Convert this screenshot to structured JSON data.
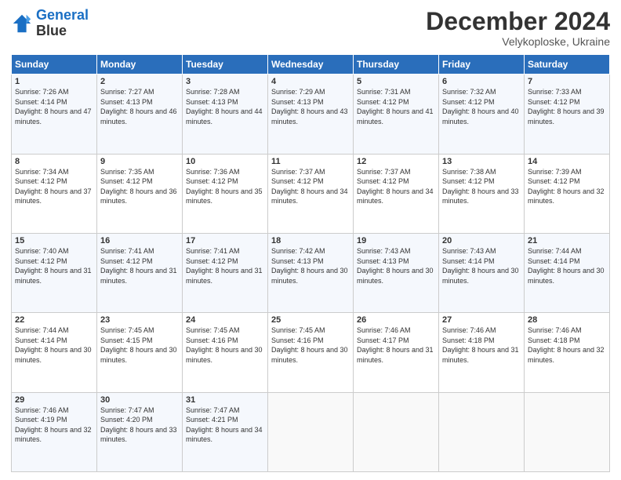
{
  "logo": {
    "line1": "General",
    "line2": "Blue"
  },
  "header": {
    "month": "December 2024",
    "location": "Velykoploske, Ukraine"
  },
  "days": [
    "Sunday",
    "Monday",
    "Tuesday",
    "Wednesday",
    "Thursday",
    "Friday",
    "Saturday"
  ],
  "weeks": [
    [
      {
        "day": "1",
        "sunrise": "Sunrise: 7:26 AM",
        "sunset": "Sunset: 4:14 PM",
        "daylight": "Daylight: 8 hours and 47 minutes."
      },
      {
        "day": "2",
        "sunrise": "Sunrise: 7:27 AM",
        "sunset": "Sunset: 4:13 PM",
        "daylight": "Daylight: 8 hours and 46 minutes."
      },
      {
        "day": "3",
        "sunrise": "Sunrise: 7:28 AM",
        "sunset": "Sunset: 4:13 PM",
        "daylight": "Daylight: 8 hours and 44 minutes."
      },
      {
        "day": "4",
        "sunrise": "Sunrise: 7:29 AM",
        "sunset": "Sunset: 4:13 PM",
        "daylight": "Daylight: 8 hours and 43 minutes."
      },
      {
        "day": "5",
        "sunrise": "Sunrise: 7:31 AM",
        "sunset": "Sunset: 4:12 PM",
        "daylight": "Daylight: 8 hours and 41 minutes."
      },
      {
        "day": "6",
        "sunrise": "Sunrise: 7:32 AM",
        "sunset": "Sunset: 4:12 PM",
        "daylight": "Daylight: 8 hours and 40 minutes."
      },
      {
        "day": "7",
        "sunrise": "Sunrise: 7:33 AM",
        "sunset": "Sunset: 4:12 PM",
        "daylight": "Daylight: 8 hours and 39 minutes."
      }
    ],
    [
      {
        "day": "8",
        "sunrise": "Sunrise: 7:34 AM",
        "sunset": "Sunset: 4:12 PM",
        "daylight": "Daylight: 8 hours and 37 minutes."
      },
      {
        "day": "9",
        "sunrise": "Sunrise: 7:35 AM",
        "sunset": "Sunset: 4:12 PM",
        "daylight": "Daylight: 8 hours and 36 minutes."
      },
      {
        "day": "10",
        "sunrise": "Sunrise: 7:36 AM",
        "sunset": "Sunset: 4:12 PM",
        "daylight": "Daylight: 8 hours and 35 minutes."
      },
      {
        "day": "11",
        "sunrise": "Sunrise: 7:37 AM",
        "sunset": "Sunset: 4:12 PM",
        "daylight": "Daylight: 8 hours and 34 minutes."
      },
      {
        "day": "12",
        "sunrise": "Sunrise: 7:37 AM",
        "sunset": "Sunset: 4:12 PM",
        "daylight": "Daylight: 8 hours and 34 minutes."
      },
      {
        "day": "13",
        "sunrise": "Sunrise: 7:38 AM",
        "sunset": "Sunset: 4:12 PM",
        "daylight": "Daylight: 8 hours and 33 minutes."
      },
      {
        "day": "14",
        "sunrise": "Sunrise: 7:39 AM",
        "sunset": "Sunset: 4:12 PM",
        "daylight": "Daylight: 8 hours and 32 minutes."
      }
    ],
    [
      {
        "day": "15",
        "sunrise": "Sunrise: 7:40 AM",
        "sunset": "Sunset: 4:12 PM",
        "daylight": "Daylight: 8 hours and 31 minutes."
      },
      {
        "day": "16",
        "sunrise": "Sunrise: 7:41 AM",
        "sunset": "Sunset: 4:12 PM",
        "daylight": "Daylight: 8 hours and 31 minutes."
      },
      {
        "day": "17",
        "sunrise": "Sunrise: 7:41 AM",
        "sunset": "Sunset: 4:12 PM",
        "daylight": "Daylight: 8 hours and 31 minutes."
      },
      {
        "day": "18",
        "sunrise": "Sunrise: 7:42 AM",
        "sunset": "Sunset: 4:13 PM",
        "daylight": "Daylight: 8 hours and 30 minutes."
      },
      {
        "day": "19",
        "sunrise": "Sunrise: 7:43 AM",
        "sunset": "Sunset: 4:13 PM",
        "daylight": "Daylight: 8 hours and 30 minutes."
      },
      {
        "day": "20",
        "sunrise": "Sunrise: 7:43 AM",
        "sunset": "Sunset: 4:14 PM",
        "daylight": "Daylight: 8 hours and 30 minutes."
      },
      {
        "day": "21",
        "sunrise": "Sunrise: 7:44 AM",
        "sunset": "Sunset: 4:14 PM",
        "daylight": "Daylight: 8 hours and 30 minutes."
      }
    ],
    [
      {
        "day": "22",
        "sunrise": "Sunrise: 7:44 AM",
        "sunset": "Sunset: 4:14 PM",
        "daylight": "Daylight: 8 hours and 30 minutes."
      },
      {
        "day": "23",
        "sunrise": "Sunrise: 7:45 AM",
        "sunset": "Sunset: 4:15 PM",
        "daylight": "Daylight: 8 hours and 30 minutes."
      },
      {
        "day": "24",
        "sunrise": "Sunrise: 7:45 AM",
        "sunset": "Sunset: 4:16 PM",
        "daylight": "Daylight: 8 hours and 30 minutes."
      },
      {
        "day": "25",
        "sunrise": "Sunrise: 7:45 AM",
        "sunset": "Sunset: 4:16 PM",
        "daylight": "Daylight: 8 hours and 30 minutes."
      },
      {
        "day": "26",
        "sunrise": "Sunrise: 7:46 AM",
        "sunset": "Sunset: 4:17 PM",
        "daylight": "Daylight: 8 hours and 31 minutes."
      },
      {
        "day": "27",
        "sunrise": "Sunrise: 7:46 AM",
        "sunset": "Sunset: 4:18 PM",
        "daylight": "Daylight: 8 hours and 31 minutes."
      },
      {
        "day": "28",
        "sunrise": "Sunrise: 7:46 AM",
        "sunset": "Sunset: 4:18 PM",
        "daylight": "Daylight: 8 hours and 32 minutes."
      }
    ],
    [
      {
        "day": "29",
        "sunrise": "Sunrise: 7:46 AM",
        "sunset": "Sunset: 4:19 PM",
        "daylight": "Daylight: 8 hours and 32 minutes."
      },
      {
        "day": "30",
        "sunrise": "Sunrise: 7:47 AM",
        "sunset": "Sunset: 4:20 PM",
        "daylight": "Daylight: 8 hours and 33 minutes."
      },
      {
        "day": "31",
        "sunrise": "Sunrise: 7:47 AM",
        "sunset": "Sunset: 4:21 PM",
        "daylight": "Daylight: 8 hours and 34 minutes."
      },
      null,
      null,
      null,
      null
    ]
  ]
}
